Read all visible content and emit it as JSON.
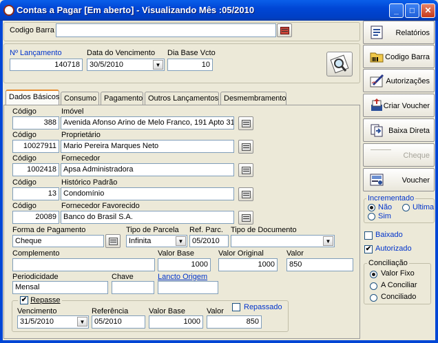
{
  "window": {
    "title": "Contas a Pagar [Em aberto] - Visualizando Mês :05/2010"
  },
  "top": {
    "codigo_barra_label": "Codigo Barra",
    "codigo_barra_value": ""
  },
  "header": {
    "lancamento_label": "Nº Lançamento",
    "lancamento_value": "140718",
    "vencimento_label": "Data do Vencimento",
    "vencimento_value": "30/5/2010",
    "dia_base_label": "Dia Base Vcto",
    "dia_base_value": "10"
  },
  "tabs": [
    "Dados Básicos",
    "Consumo",
    "Pagamento",
    "Outros Lançamentos",
    "Desmembramento"
  ],
  "form": {
    "imovel": {
      "code_label": "Código",
      "code": "388",
      "name_label": "Imóvel",
      "name": "Avenida Afonso Arino de Melo Franco, 191 Apto 31"
    },
    "proprietario": {
      "code_label": "Código",
      "code": "10027911",
      "name_label": "Proprietário",
      "name": "Mario Pereira Marques Neto"
    },
    "fornecedor": {
      "code_label": "Código",
      "code": "1002418",
      "name_label": "Fornecedor",
      "name": "Apsa Administradora"
    },
    "historico": {
      "code_label": "Código",
      "code": "13",
      "name_label": "Histórico Padrão",
      "name": "Condomínio"
    },
    "fornecedor_fav": {
      "code_label": "Código",
      "code": "20089",
      "name_label": "Fornecedor Favorecido",
      "name": "Banco do Brasil S.A."
    },
    "forma_pagamento_label": "Forma de Pagamento",
    "forma_pagamento": "Cheque",
    "tipo_parcela_label": "Tipo de Parcela",
    "tipo_parcela": "Infinita",
    "ref_parc_label": "Ref. Parc.",
    "ref_parc": "05/2010",
    "tipo_documento_label": "Tipo de Documento",
    "tipo_documento": "",
    "complemento_label": "Complemento",
    "complemento": "",
    "valor_base_label": "Valor Base",
    "valor_base": "1000",
    "valor_original_label": "Valor Original",
    "valor_original": "1000",
    "valor_label": "Valor",
    "valor": "850",
    "periodicidade_label": "Periodicidade",
    "periodicidade": "Mensal",
    "chave_label": "Chave",
    "chave": "",
    "lancto_origem_label": "Lancto Origem",
    "lancto_origem": ""
  },
  "repasse": {
    "label": "Repasse",
    "checked": true,
    "vencimento_label": "Vencimento",
    "vencimento": "31/5/2010",
    "referencia_label": "Referência",
    "referencia": "05/2010",
    "valor_base_label": "Valor Base",
    "valor_base": "1000",
    "valor_label": "Valor",
    "valor": "850",
    "repassado_label": "Repassado"
  },
  "sidebar": {
    "buttons": [
      "Relatórios",
      "Codigo Barra",
      "Autorizações",
      "Criar Voucher",
      "Baixa Direta",
      "Cheque",
      "Voucher"
    ],
    "incrementado_label": "Incrementado",
    "incrementado_options": [
      "Não",
      "Ultima",
      "Sim"
    ],
    "baixado_label": "Baixado",
    "autorizado_label": "Autorizado",
    "conciliacao_label": "Conciliação",
    "conciliacao_options": [
      "Valor Fixo",
      "A Conciliar",
      "Conciliado"
    ]
  },
  "colors": {
    "titlebar": "#0046D5",
    "panel": "#ECE9D8",
    "link": "#0033CC",
    "tab_highlight": "#E68B2C"
  }
}
